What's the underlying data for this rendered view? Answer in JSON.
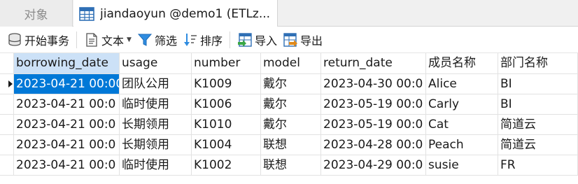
{
  "tabs": [
    {
      "label": "对象"
    },
    {
      "label": "jiandaoyun @demo1 (ETLz..."
    }
  ],
  "toolbar": {
    "begin_transaction": "开始事务",
    "text": "文本",
    "filter": "筛选",
    "sort": "排序",
    "import": "导入",
    "export": "导出"
  },
  "table": {
    "columns": [
      "borrowing_date",
      "usage",
      "number",
      "model",
      "return_date",
      "成员名称",
      "部门名称"
    ],
    "rows": [
      [
        "2023-04-21 00:00",
        "团队公用",
        "K1009",
        "戴尔",
        "2023-04-30 00:0",
        "Alice",
        "BI"
      ],
      [
        "2023-04-21 00:0",
        "临时使用",
        "K1006",
        "戴尔",
        "2023-05-19 00:0",
        "Carly",
        "BI"
      ],
      [
        "2023-04-21 00:0",
        "长期领用",
        "K1010",
        "戴尔",
        "2023-05-19 00:0",
        "Cat",
        "简道云"
      ],
      [
        "2023-04-21 00:0",
        "长期领用",
        "K1004",
        "联想",
        "2023-04-28 00:0",
        "Peach",
        "简道云"
      ],
      [
        "2023-04-21 00:0",
        "临时使用",
        "K1002",
        "联想",
        "2023-04-29 00:0",
        "susie",
        "FR"
      ]
    ]
  },
  "colors": {
    "selection": "#0078d7",
    "header_highlight": "#cce1f7"
  }
}
